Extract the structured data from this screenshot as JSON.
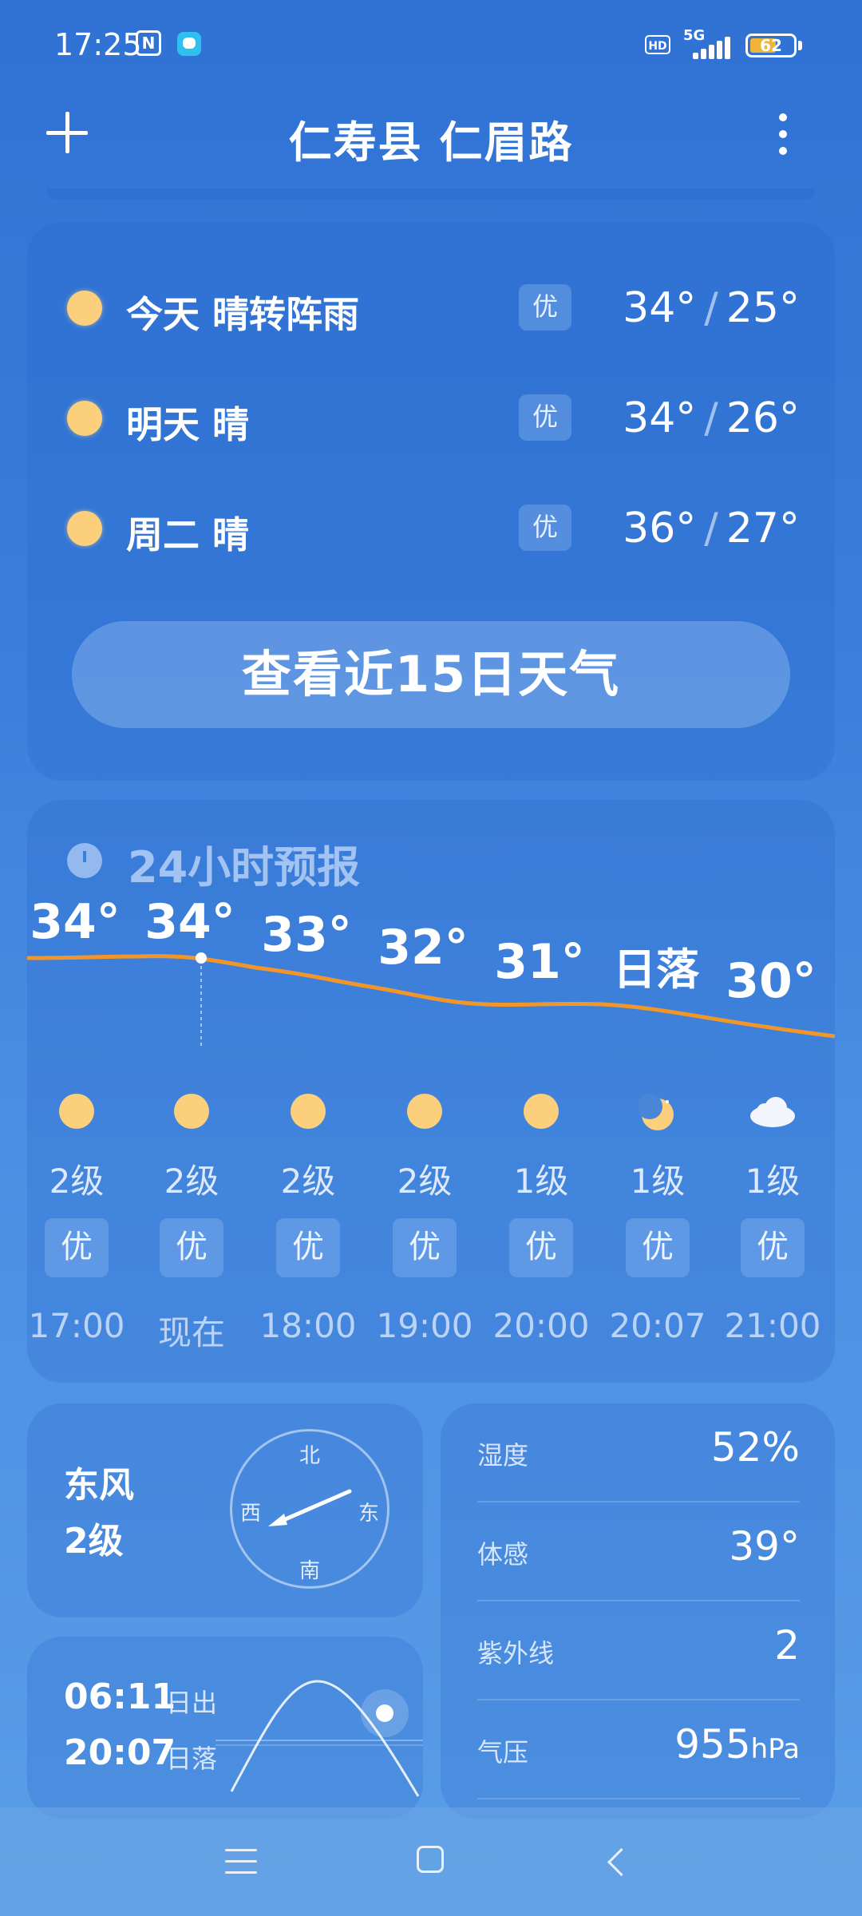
{
  "status_bar": {
    "time": "17:25",
    "nfc_icon": "N",
    "hd_label": "HD",
    "network": "5G",
    "battery_level": "62",
    "battery_color": "#f0b43a"
  },
  "header": {
    "location": "仁寿县 仁眉路"
  },
  "daily": {
    "days": [
      {
        "label": "今天  晴转阵雨",
        "aqi": "优",
        "high": "34°",
        "low": "25°",
        "icon": "sun-icon"
      },
      {
        "label": "明天  晴",
        "aqi": "优",
        "high": "34°",
        "low": "26°",
        "icon": "sun-icon"
      },
      {
        "label": "周二  晴",
        "aqi": "优",
        "high": "36°",
        "low": "27°",
        "icon": "sun-icon"
      }
    ],
    "button_label": "查看近15日天气"
  },
  "hourly": {
    "title": "24小时预报",
    "hours": [
      {
        "temp": "34°",
        "icon": "sun-icon",
        "wind": "2级",
        "aqi": "优",
        "time": "17:00"
      },
      {
        "temp": "34°",
        "icon": "sun-icon",
        "wind": "2级",
        "aqi": "优",
        "time": "现在"
      },
      {
        "temp": "33°",
        "icon": "sun-icon",
        "wind": "2级",
        "aqi": "优",
        "time": "18:00"
      },
      {
        "temp": "32°",
        "icon": "sun-icon",
        "wind": "2级",
        "aqi": "优",
        "time": "19:00"
      },
      {
        "temp": "31°",
        "icon": "sun-icon",
        "wind": "1级",
        "aqi": "优",
        "time": "20:00"
      },
      {
        "temp": "日落",
        "icon": "moon-icon",
        "wind": "1级",
        "aqi": "优",
        "time": "20:07"
      },
      {
        "temp": "30°",
        "icon": "cloud-icon",
        "wind": "1级",
        "aqi": "优",
        "time": "21:00"
      }
    ],
    "line_color": "#f0962a"
  },
  "wind": {
    "direction": "东风",
    "level": "2级",
    "compass": {
      "north": "北",
      "south": "南",
      "east": "东",
      "west": "西"
    }
  },
  "details": [
    {
      "label": "湿度",
      "value": "52%",
      "unit": ""
    },
    {
      "label": "体感",
      "value": "39°",
      "unit": ""
    },
    {
      "label": "紫外线",
      "value": "2",
      "unit": ""
    },
    {
      "label": "气压",
      "value": "955",
      "unit": "hPa"
    }
  ],
  "sun": {
    "sunrise_time": "06:11",
    "sunrise_label": "日出",
    "sunset_time": "20:07",
    "sunset_label": "日落"
  }
}
